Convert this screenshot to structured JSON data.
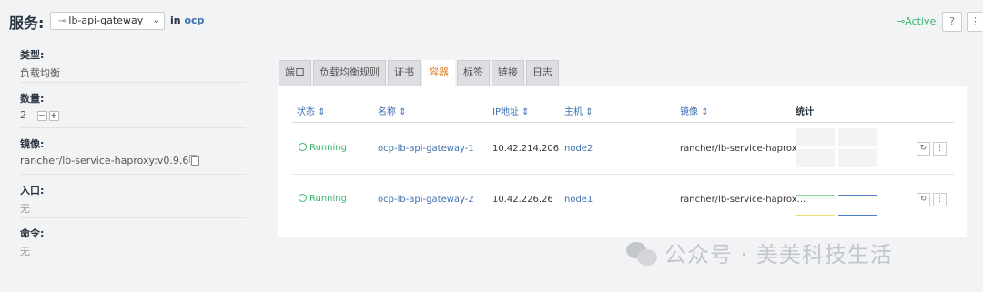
{
  "header": {
    "title": "服务:",
    "selected_service": "lb-api-gateway",
    "in_label": "in",
    "namespace": "ocp",
    "status": "Active"
  },
  "info": {
    "type_label": "类型:",
    "type_value": "负载均衡",
    "quantity_label": "数量:",
    "quantity_value": "2",
    "image_label": "镜像:",
    "image_value": "rancher/lb-service-haproxy:v0.9.6",
    "entry_label": "入口:",
    "entry_value": "无",
    "command_label": "命令:",
    "command_value": "无"
  },
  "tabs": [
    {
      "label": "端口"
    },
    {
      "label": "负载均衡规则"
    },
    {
      "label": "证书"
    },
    {
      "label": "容器"
    },
    {
      "label": "标签"
    },
    {
      "label": "链接"
    },
    {
      "label": "日志"
    }
  ],
  "table": {
    "columns": [
      "状态",
      "名称",
      "IP地址",
      "主机",
      "镜像",
      "统计"
    ],
    "rows": [
      {
        "state": "Running",
        "name": "ocp-lb-api-gateway-1",
        "ip": "10.42.214.206",
        "host": "node2",
        "image": "rancher/lb-service-haprox..."
      },
      {
        "state": "Running",
        "name": "ocp-lb-api-gateway-2",
        "ip": "10.42.226.26",
        "host": "node1",
        "image": "rancher/lb-service-haprox..."
      }
    ]
  },
  "watermark": "公众号 · 美美科技生活",
  "colors": {
    "accent": "#e07b24",
    "link": "#3d6fae",
    "running": "#3bb56e",
    "stat_green": "#8fd6a1",
    "stat_blue": "#4a7cc7",
    "stat_yellow": "#f2d97a"
  }
}
